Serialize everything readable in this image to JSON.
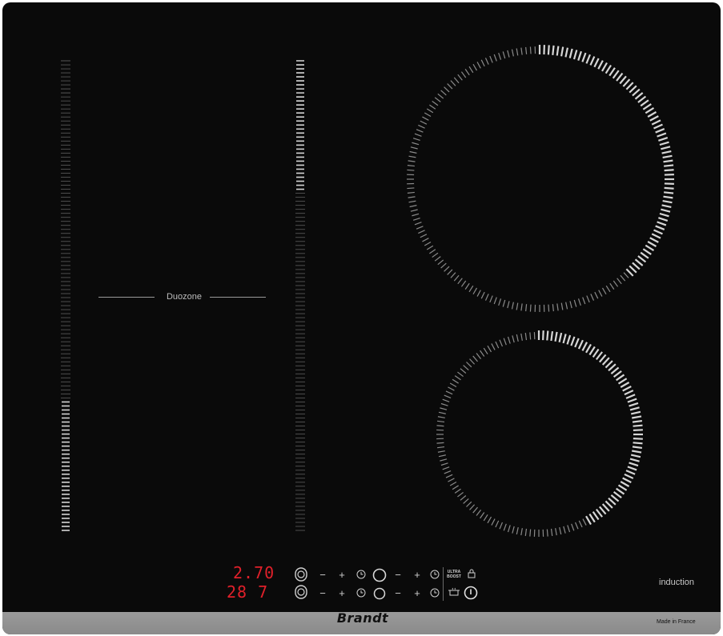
{
  "hob": {
    "surface_color": "#0a0a0a",
    "strip_color": "#8f8f8f",
    "accent_display": "#e0202a"
  },
  "labels": {
    "duozone": "Duozone",
    "induction": "induction",
    "brand": "Brandt",
    "made_in": "Made in France"
  },
  "display": {
    "row1": "2.70",
    "row2": "28 7"
  },
  "controls": {
    "row1": [
      "slider-toggle",
      "minus",
      "plus",
      "timer",
      "zone-circle",
      "minus",
      "plus",
      "timer",
      "ultra-boost",
      "lock"
    ],
    "row2": [
      "slider-toggle",
      "minus",
      "plus",
      "timer",
      "zone-circle",
      "minus",
      "plus",
      "timer",
      "keep-warm",
      "power"
    ],
    "minus_symbol": "−",
    "plus_symbol": "+",
    "ultra_boost_line1": "ULTRA",
    "ultra_boost_line2": "BOOST"
  },
  "icons": {
    "timer": "clock-icon",
    "lock": "lock-icon",
    "keep_warm": "pot-icon",
    "power": "power-icon",
    "zone": "zone-circle-icon"
  },
  "power_levels": {
    "left_slider_fraction": 0.28,
    "center_slider_fraction": 0.72,
    "top_right_ring_fraction": 0.38,
    "bottom_right_ring_fraction": 0.42
  }
}
